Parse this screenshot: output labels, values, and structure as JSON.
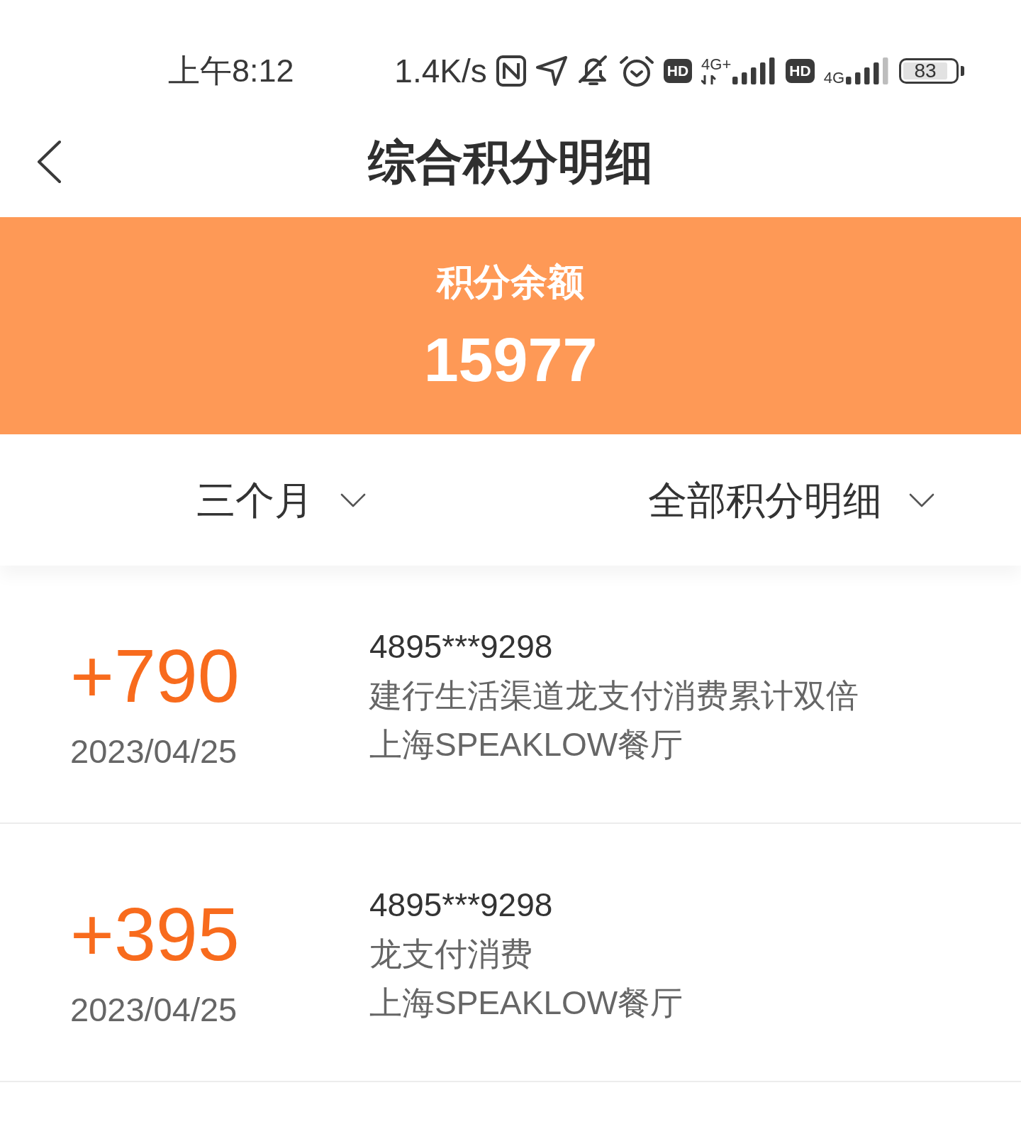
{
  "status_bar": {
    "time": "上午8:12",
    "net_speed": "1.4K/s",
    "sims": [
      {
        "badge": "HD",
        "network": "4G+"
      },
      {
        "badge": "HD",
        "network": "4G"
      }
    ],
    "battery": "83"
  },
  "header": {
    "title": "综合积分明细"
  },
  "balance": {
    "label": "积分余额",
    "value": "15977"
  },
  "filters": [
    {
      "label": "三个月"
    },
    {
      "label": "全部积分明细"
    }
  ],
  "records": [
    {
      "amount": "+790",
      "date": "2023/04/25",
      "card": "4895***9298",
      "description": "建行生活渠道龙支付消费累计双倍",
      "merchant": "上海SPEAKLOW餐厅"
    },
    {
      "amount": "+395",
      "date": "2023/04/25",
      "card": "4895***9298",
      "description": "龙支付消费",
      "merchant": "上海SPEAKLOW餐厅"
    }
  ]
}
